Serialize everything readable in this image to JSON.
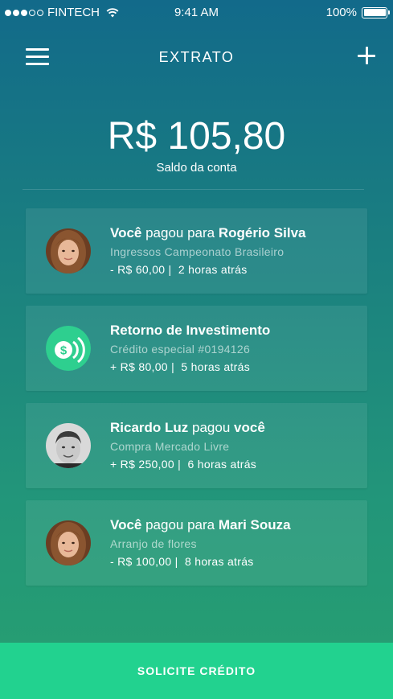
{
  "status_bar": {
    "carrier": "FINTECH",
    "time": "9:41 AM",
    "battery": "100%",
    "signal_icon": "signal-dots-icon",
    "wifi_icon": "wifi-icon",
    "battery_icon": "battery-icon",
    "signal_strength": 3,
    "battery_level": 1.0
  },
  "header": {
    "title": "EXTRATO",
    "menu_icon": "hamburger-menu-icon",
    "add_icon": "plus-icon"
  },
  "balance": {
    "value": "R$ 105,80",
    "label": "Saldo da conta"
  },
  "transactions": [
    {
      "avatar": "woman-avatar",
      "title_parts": [
        "Você",
        " pagou para ",
        "Rogério Silva"
      ],
      "subtitle": "Ingressos Campeonato Brasileiro",
      "amount": " - R$ 60,00 |",
      "time": "2 horas atrás"
    },
    {
      "avatar": "dollar-coin-icon",
      "title_parts": [
        "Retorno de Investimento",
        "",
        ""
      ],
      "subtitle": "Crédito especial #0194126",
      "amount": " + R$ 80,00 |",
      "time": "5 horas atrás"
    },
    {
      "avatar": "man-avatar",
      "title_parts": [
        "Ricardo Luz",
        " pagou ",
        "você"
      ],
      "subtitle": "Compra Mercado Livre",
      "amount": " + R$ 250,00 |",
      "time": "6 horas atrás"
    },
    {
      "avatar": "woman-avatar",
      "title_parts": [
        "Você",
        " pagou para ",
        "Mari Souza"
      ],
      "subtitle": "Arranjo de flores",
      "amount": " - R$ 100,00 |",
      "time": "8 horas atrás"
    }
  ],
  "cta": {
    "label": "SOLICITE CRÉDITO"
  },
  "colors": {
    "gradient_top": "#126a8a",
    "gradient_bottom": "#27a070",
    "cta_green": "#22d28f",
    "coin_green": "#2ecf8f"
  }
}
